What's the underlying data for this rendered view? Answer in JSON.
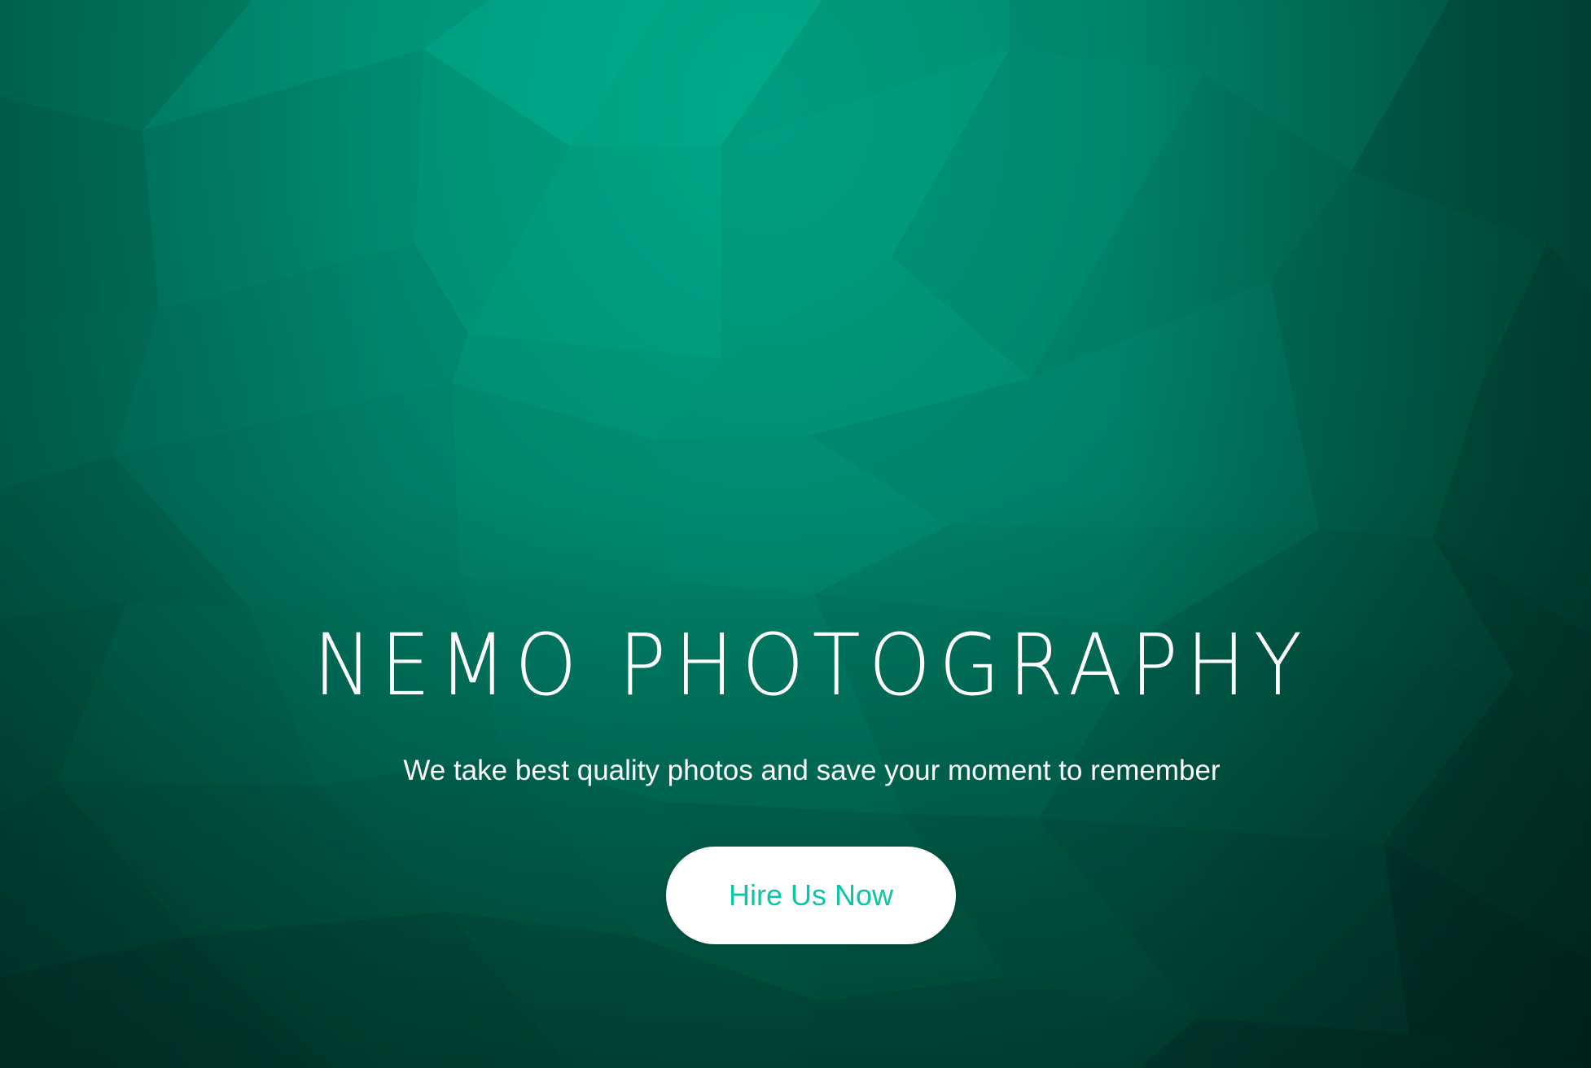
{
  "hero": {
    "title": "NEMO PHOTOGRAPHY",
    "subtitle": "We take best quality photos and save your moment to remember",
    "cta_label": "Hire Us Now"
  },
  "colors": {
    "background_primary": "#00a888",
    "background_dark": "#003f33",
    "text": "#ffffff",
    "button_background": "#ffffff",
    "button_text": "#0cc5a6"
  }
}
